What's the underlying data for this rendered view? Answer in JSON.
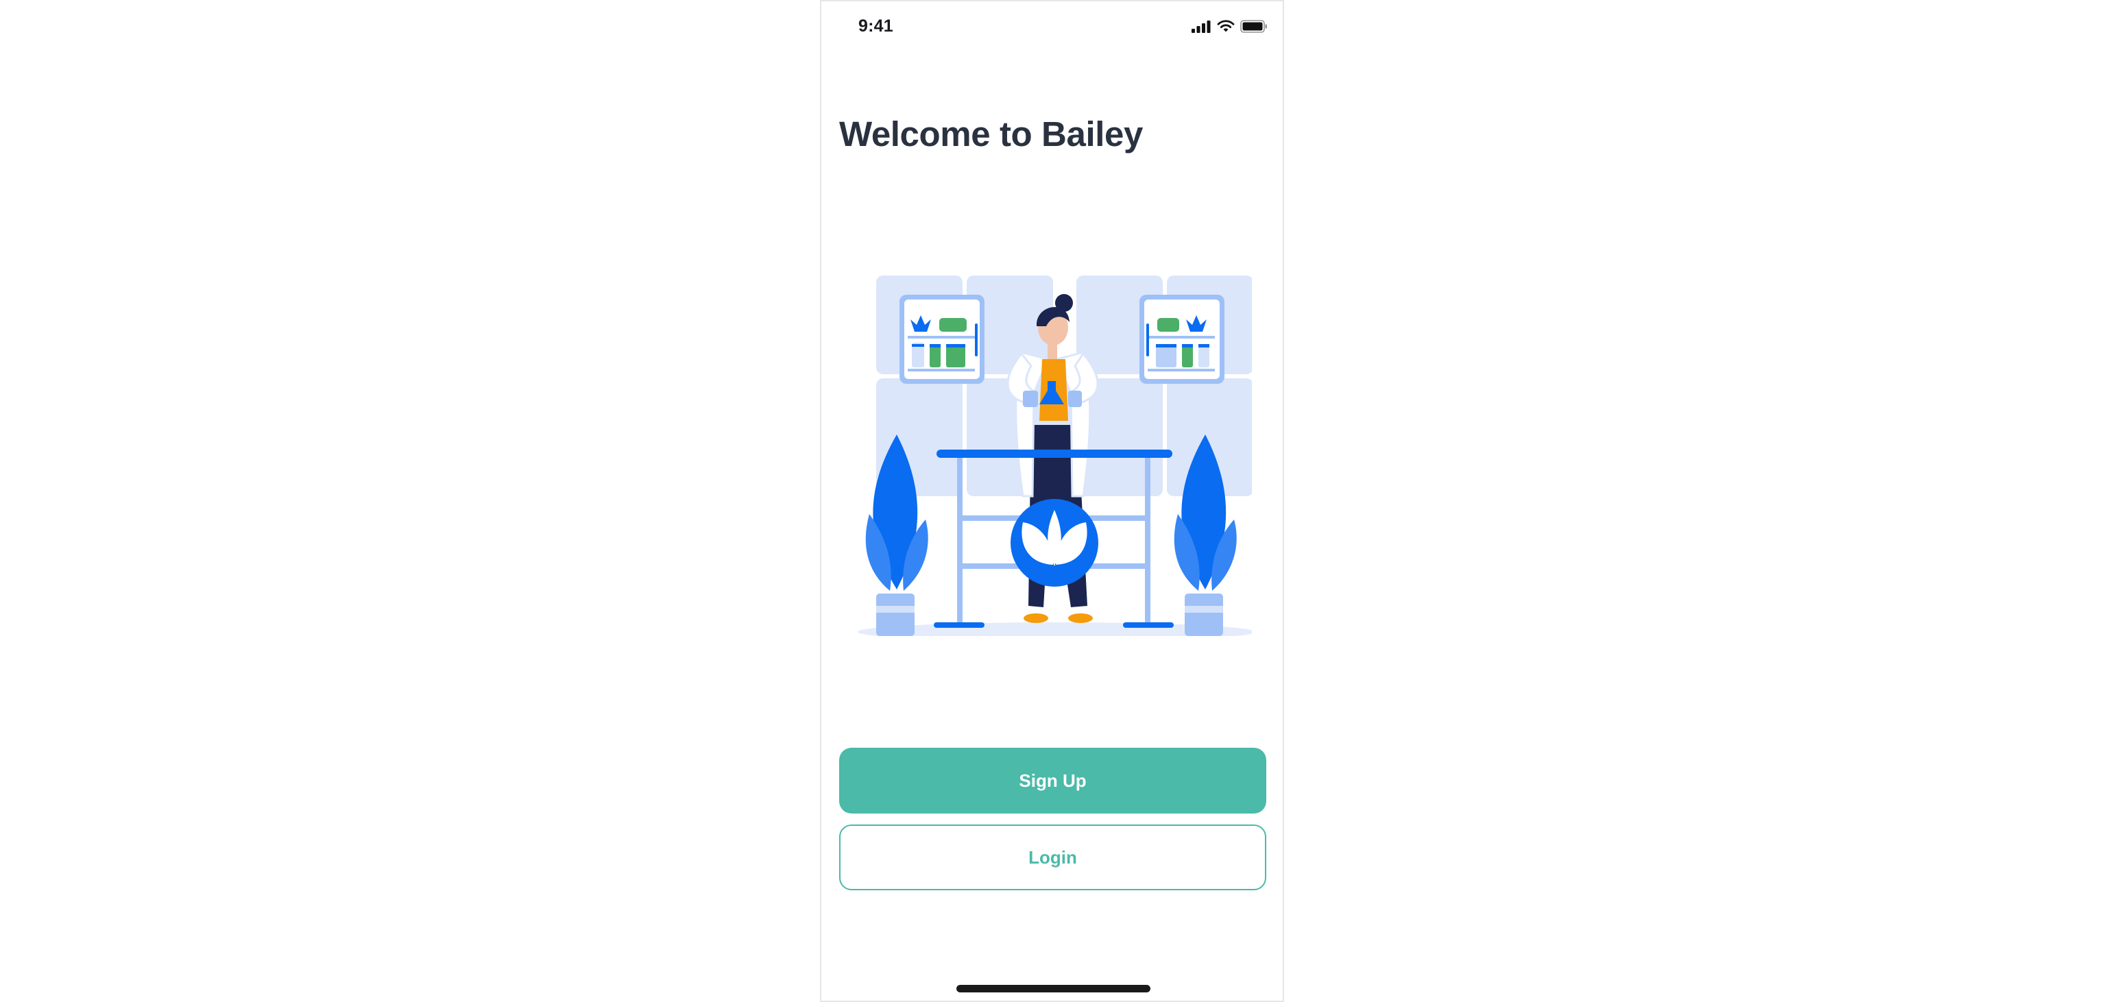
{
  "status_bar": {
    "time": "9:41",
    "icons": [
      "cellular-signal-icon",
      "wifi-icon",
      "battery-icon"
    ]
  },
  "welcome": {
    "title": "Welcome to Bailey"
  },
  "illustration": {
    "subject": "scientist-with-lab-table-and-plants-icon",
    "center_emblem": "leaf-icon"
  },
  "actions": {
    "signup_label": "Sign Up",
    "login_label": "Login"
  },
  "colors": {
    "accent": "#4bbaa8",
    "title": "#2a3240",
    "illustration_blue": "#0a6cf0",
    "illustration_light_blue": "#dbe6fb"
  }
}
